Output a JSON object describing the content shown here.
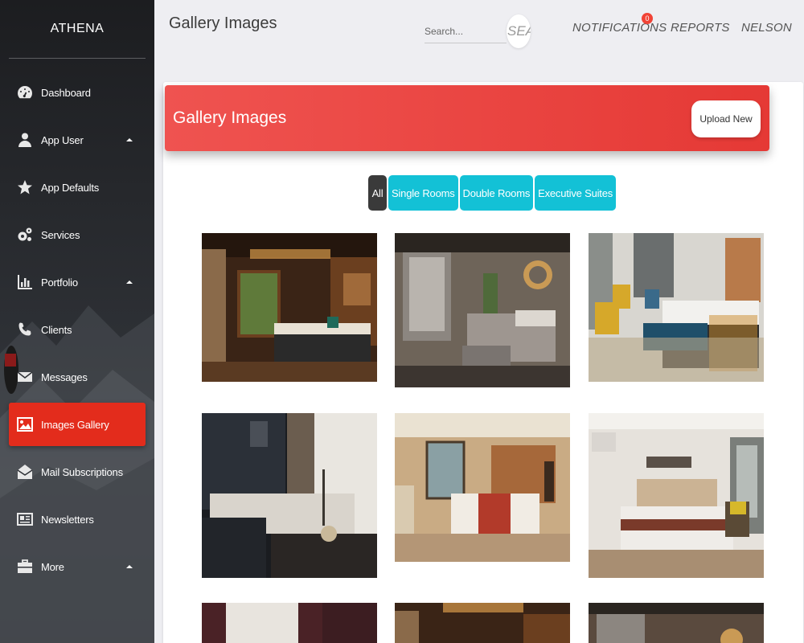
{
  "sidebar": {
    "brand": "ATHENA",
    "items": [
      {
        "label": "Dashboard",
        "icon": "dashboard-icon"
      },
      {
        "label": "App User",
        "icon": "user-icon",
        "caret": true
      },
      {
        "label": "App Defaults",
        "icon": "star-icon"
      },
      {
        "label": "Services",
        "icon": "gears-icon"
      },
      {
        "label": "Portfolio",
        "icon": "bar-chart-icon",
        "caret": true
      },
      {
        "label": "Clients",
        "icon": "phone-icon"
      },
      {
        "label": "Messages",
        "icon": "envelope-icon"
      },
      {
        "label": "Images Gallery",
        "icon": "image-icon",
        "active": true
      },
      {
        "label": "Mail Subscriptions",
        "icon": "envelope-open-icon"
      },
      {
        "label": "Newsletters",
        "icon": "newspaper-icon"
      },
      {
        "label": "More",
        "icon": "briefcase-icon",
        "caret": true
      }
    ]
  },
  "header": {
    "title": "Gallery Images",
    "search_placeholder": "Search...",
    "search_button": "SEARCH",
    "notifications_label": "NOTIFICATIONS",
    "notifications_count": "0",
    "reports_label": "REPORTS",
    "user_label": "NELSON"
  },
  "card": {
    "title": "Gallery Images",
    "upload_label": "Upload New",
    "filters": [
      "All",
      "Single Rooms",
      "Double Rooms",
      "Executive Suites"
    ],
    "active_filter": "All"
  },
  "colors": {
    "accent_red": "#e53935",
    "active_nav": "#e32c1c",
    "filter_cyan": "#13c1d6",
    "filter_active": "#3a3a3a"
  }
}
